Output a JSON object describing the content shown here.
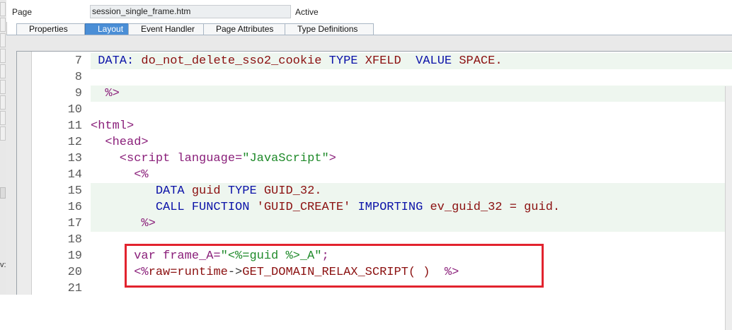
{
  "header": {
    "page_label": "Page",
    "page_value": "session_single_frame.htm",
    "status": "Active"
  },
  "tabs": [
    {
      "label": "Properties",
      "active": false
    },
    {
      "label": "Layout",
      "active": true
    },
    {
      "label": "Event Handler",
      "active": false
    },
    {
      "label": "Page Attributes",
      "active": false
    },
    {
      "label": "Type Definitions",
      "active": false
    }
  ],
  "left_strip_fragment": "v:",
  "code": {
    "line_numbers": [
      "7",
      "8",
      "9",
      "10",
      "11",
      "12",
      "13",
      "14",
      "15",
      "16",
      "17",
      "18",
      "19",
      "20",
      "21"
    ],
    "lines": [
      [
        {
          "t": " DATA: ",
          "c": "t-kw"
        },
        {
          "t": "do_not_delete_sso2_cookie",
          "c": "t-id"
        },
        {
          "t": " TYPE ",
          "c": "t-kw"
        },
        {
          "t": "XFELD",
          "c": "t-id"
        },
        {
          "t": "  VALUE ",
          "c": "t-kw"
        },
        {
          "t": "SPACE.",
          "c": "t-id"
        }
      ],
      [],
      [
        {
          "t": "  %>",
          "c": "t-tag"
        }
      ],
      [],
      [
        {
          "t": "<html>",
          "c": "t-tag"
        }
      ],
      [
        {
          "t": "  <head>",
          "c": "t-tag"
        }
      ],
      [
        {
          "t": "    <script language=",
          "c": "t-tag"
        },
        {
          "t": "\"JavaScript\"",
          "c": "t-str"
        },
        {
          "t": ">",
          "c": "t-tag"
        }
      ],
      [
        {
          "t": "      <%",
          "c": "t-tag"
        }
      ],
      [
        {
          "t": "         DATA ",
          "c": "t-kw"
        },
        {
          "t": "guid",
          "c": "t-id"
        },
        {
          "t": " TYPE ",
          "c": "t-kw"
        },
        {
          "t": "GUID_32.",
          "c": "t-id"
        }
      ],
      [
        {
          "t": "         CALL FUNCTION ",
          "c": "t-kw"
        },
        {
          "t": "'GUID_CREATE'",
          "c": "t-id"
        },
        {
          "t": " IMPORTING ",
          "c": "t-kw"
        },
        {
          "t": "ev_guid_32 = guid.",
          "c": "t-id"
        }
      ],
      [
        {
          "t": "       %>",
          "c": "t-tag"
        }
      ],
      [],
      [
        {
          "t": "      var frame_A=",
          "c": "t-js"
        },
        {
          "t": "\"<%=guid %>_A\"",
          "c": "t-str"
        },
        {
          "t": ";",
          "c": "t-js"
        }
      ],
      [
        {
          "t": "      <%",
          "c": "t-tag"
        },
        {
          "t": "raw=runtime",
          "c": "t-id"
        },
        {
          "t": "->",
          "c": "t-op"
        },
        {
          "t": "GET_DOMAIN_RELAX_SCRIPT( )  ",
          "c": "t-id"
        },
        {
          "t": "%>",
          "c": "t-tag"
        }
      ],
      []
    ],
    "highlighted": [
      true,
      false,
      true,
      false,
      false,
      false,
      false,
      false,
      true,
      true,
      true,
      false,
      false,
      false,
      false
    ]
  },
  "annotation_color": "#e2232e"
}
